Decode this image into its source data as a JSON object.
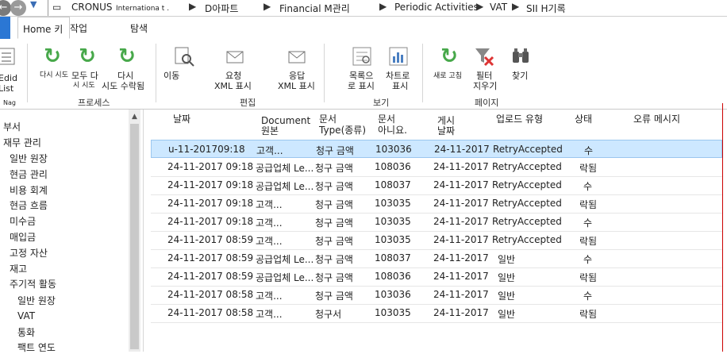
{
  "breadcrumb": {
    "company": "CRONUS",
    "company_sub": "Internationa t .",
    "sep": "▶",
    "items": [
      "D아파트",
      "Financial M관리",
      "Periodic Activities",
      "VAT",
      "SII H기록"
    ]
  },
  "ribbon_tabs": {
    "home": "Home 키",
    "actions": "작업",
    "navigate": "탐색"
  },
  "ribbon": {
    "edit_list_1": "Edid",
    "edit_list_2": "List",
    "nav_label": "Nag",
    "btn_retry_all_small": "다시 시도",
    "btn_all_1": "모두 다",
    "btn_all_small": "시 시도",
    "btn_retry_1": "다시",
    "btn_retry_2": "시도 수락됨",
    "grp_process": "프로세스",
    "btn_history": "이동",
    "btn_request_1": "요청",
    "btn_request_2": "XML 표시",
    "btn_response_1": "응답",
    "btn_response_2": "XML 표시",
    "grp_edit": "편집",
    "btn_list_1": "목록으",
    "btn_list_2": "로 표시",
    "btn_chart_1": "차트로",
    "btn_chart_2": "표시",
    "grp_view": "보기",
    "btn_refresh": "새로 고침",
    "btn_filter_1": "필터",
    "btn_filter_2": "지우기",
    "btn_find": "찾기",
    "grp_page": "페이지"
  },
  "sidebar": {
    "items": [
      "부서",
      "재무 관리",
      "일반 원장",
      "현금 관리",
      "비용 회계",
      "현금 흐름",
      "미수금",
      "매입금",
      "고정 자산",
      "재고",
      "주기적 활동",
      "일반 원장",
      "VAT",
      "통화",
      "팩트 연도"
    ]
  },
  "columns": {
    "date": "날짜",
    "doc_source_1": "Document",
    "doc_source_2": "원본",
    "doc_type_1": "문서",
    "doc_type_2": "Type(종류)",
    "doc_no_1": "문서",
    "doc_no_2": "아니요.",
    "posting_1": "게시",
    "posting_2": "날짜",
    "upload_type": "업로드 유형",
    "status": "상태",
    "error": "오류 메시지"
  },
  "rows": [
    {
      "date": "u-11-201709:18",
      "source": "고객...",
      "doctype": "청구 금액",
      "docno": "103036",
      "posting": "24-11-2017",
      "upload": "RetryAccepted",
      "status": "수"
    },
    {
      "date": "24-11-2017 09:18",
      "source": "공급업체 Le...",
      "doctype": "청구 금액",
      "docno": "108036",
      "posting": "24-11-2017",
      "upload": "RetryAccepted",
      "status": "락됨"
    },
    {
      "date": "24-11-2017 09:18",
      "source": "공급업체 Le...",
      "doctype": "청구 금액",
      "docno": "108037",
      "posting": "24-11-2017",
      "upload": "RetryAccepted",
      "status": "수"
    },
    {
      "date": "24-11-2017 09:18",
      "source": "고객...",
      "doctype": "청구 금액",
      "docno": "103035",
      "posting": "24-11-2017",
      "upload": "RetryAccepted",
      "status": "락됨"
    },
    {
      "date": "24-11-2017 09:18",
      "source": "고객...",
      "doctype": "청구 금액",
      "docno": "103035",
      "posting": "24-11-2017",
      "upload": "RetryAccepted",
      "status": "수"
    },
    {
      "date": "24-11-2017 08:59",
      "source": "고객...",
      "doctype": "청구 금액",
      "docno": "103035",
      "posting": "24-11-2017",
      "upload": "RetryAccepted",
      "status": "락됨"
    },
    {
      "date": "24-11-2017 08:59",
      "source": "공급업체 Le...",
      "doctype": "청구 금액",
      "docno": "108037",
      "posting": "24-11-2017",
      "upload": "일반",
      "status": "수"
    },
    {
      "date": "24-11-2017 08:59",
      "source": "공급업체 Le...",
      "doctype": "청구 금액",
      "docno": "108036",
      "posting": "24-11-2017",
      "upload": "일반",
      "status": "락됨"
    },
    {
      "date": "24-11-2017 08:58",
      "source": "고객...",
      "doctype": "청구 금액",
      "docno": "103036",
      "posting": "24-11-2017",
      "upload": "일반",
      "status": "수"
    },
    {
      "date": "24-11-2017 08:58",
      "source": "고객...",
      "doctype": "청구서",
      "docno": "103035",
      "posting": "24-11-2017",
      "upload": "일반",
      "status": "락됨"
    }
  ],
  "colors": {
    "accent": "#2b77d4",
    "selected_row": "#cde8ff",
    "refresh_icon": "#47a84a"
  }
}
